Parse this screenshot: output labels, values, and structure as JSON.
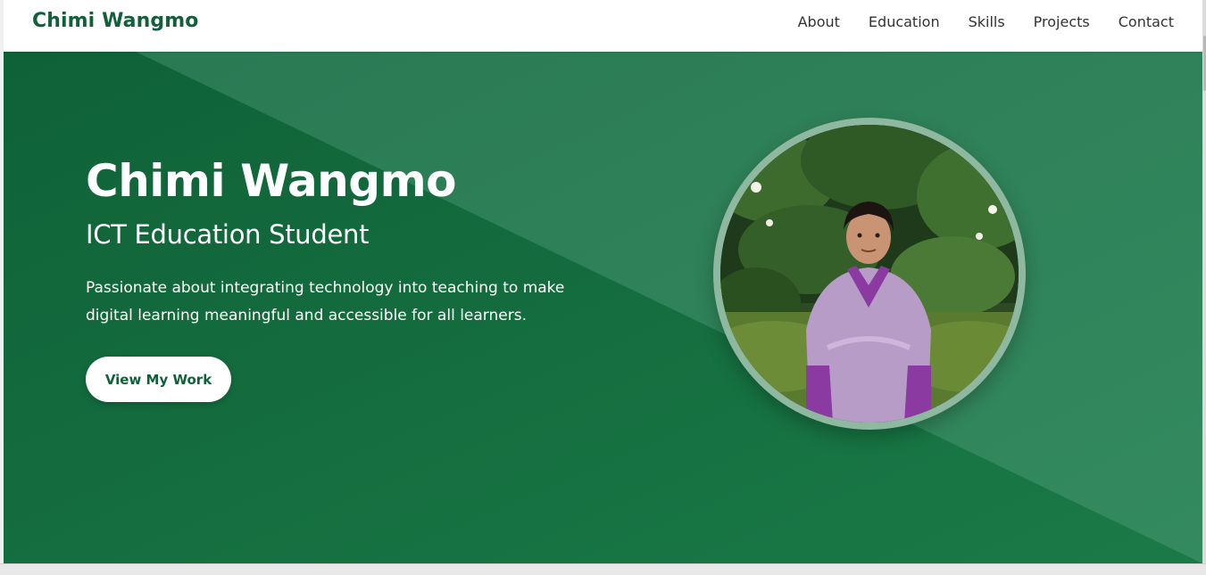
{
  "nav": {
    "brand": "Chimi Wangmo",
    "links": [
      {
        "label": "About"
      },
      {
        "label": "Education"
      },
      {
        "label": "Skills"
      },
      {
        "label": "Projects"
      },
      {
        "label": "Contact"
      }
    ]
  },
  "hero": {
    "name": "Chimi Wangmo",
    "subtitle": "ICT Education Student",
    "description": "Passionate about integrating technology into teaching to make digital learning meaningful and accessible for all learners.",
    "cta_label": "View My Work",
    "photo_alt": "Chimi Wangmo"
  },
  "colors": {
    "brand_green": "#12603a",
    "hero_green": "#16713f",
    "hero_light_green": "#2e7d55",
    "text_dark": "#333333"
  }
}
